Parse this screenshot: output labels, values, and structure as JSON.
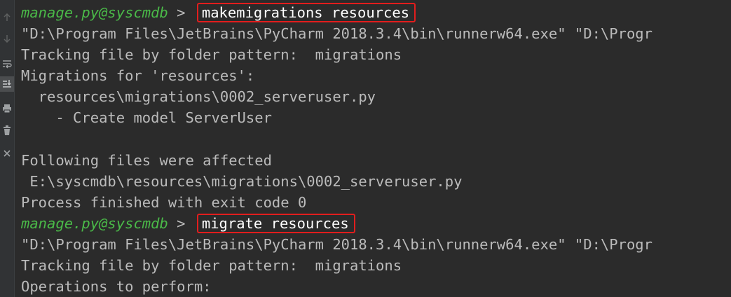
{
  "gutter": {
    "icons": [
      "arrow-up-icon",
      "arrow-down-icon",
      "soft-wrap-icon",
      "scroll-to-end-icon",
      "print-icon",
      "trash-icon",
      "close-icon"
    ]
  },
  "console": {
    "prompt": "manage.py@syscmdb",
    "arrow": ">",
    "cmd1": "makemigrations resources",
    "l2": "\"D:\\Program Files\\JetBrains\\PyCharm 2018.3.4\\bin\\runnerw64.exe\" \"D:\\Progr",
    "l3": "Tracking file by folder pattern:  migrations",
    "l4": "Migrations for 'resources':",
    "l5": "  resources\\migrations\\0002_serveruser.py",
    "l6": "    - Create model ServerUser",
    "l7": "",
    "l8": "Following files were affected",
    "l9": " E:\\syscmdb\\resources\\migrations\\0002_serveruser.py",
    "l10": "Process finished with exit code 0",
    "cmd2": "migrate resources",
    "l12": "\"D:\\Program Files\\JetBrains\\PyCharm 2018.3.4\\bin\\runnerw64.exe\" \"D:\\Progr",
    "l13": "Tracking file by folder pattern:  migrations",
    "l14": "Operations to perform:"
  },
  "colors": {
    "background": "#2b2b2b",
    "prompt": "#4ab948",
    "text": "#bbbbbb",
    "command": "#ffffff",
    "highlight": "#e21d1d"
  }
}
